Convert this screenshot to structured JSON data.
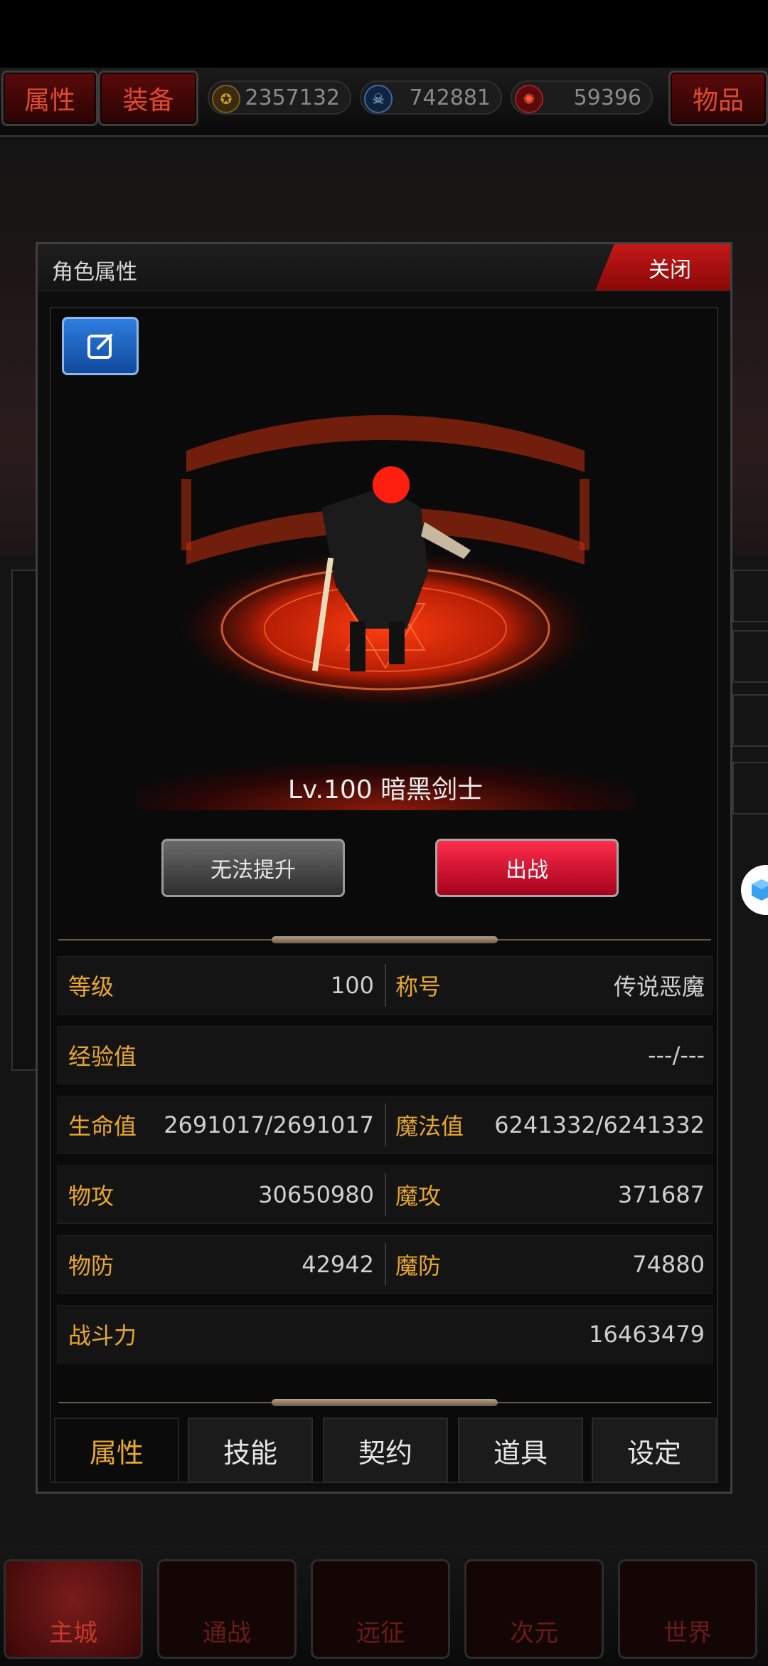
{
  "topbar": {
    "tab_attributes": "属性",
    "tab_equipment": "装备",
    "tab_items": "物品",
    "currencies": [
      {
        "icon": "gold-coin-icon",
        "value": "2357132"
      },
      {
        "icon": "blue-skull-icon",
        "value": "742881"
      },
      {
        "icon": "red-rune-icon",
        "value": "59396"
      }
    ]
  },
  "dialog": {
    "title": "角色属性",
    "close_label": "关闭",
    "character_name": "Lv.100 暗黑剑士",
    "btn_upgrade": "无法提升",
    "btn_deploy": "出战",
    "stats": {
      "level_label": "等级",
      "level_value": "100",
      "title_label": "称号",
      "title_value": "传说恶魔",
      "exp_label": "经验值",
      "exp_value": "---/---",
      "hp_label": "生命值",
      "hp_value": "2691017/2691017",
      "mp_label": "魔法值",
      "mp_value": "6241332/6241332",
      "patk_label": "物攻",
      "patk_value": "30650980",
      "matk_label": "魔攻",
      "matk_value": "371687",
      "pdef_label": "物防",
      "pdef_value": "42942",
      "mdef_label": "魔防",
      "mdef_value": "74880",
      "power_label": "战斗力",
      "power_value": "16463479"
    },
    "tabs": [
      "属性",
      "技能",
      "契约",
      "道具",
      "设定"
    ]
  },
  "bottom_nav": [
    "主城",
    "通战",
    "远征",
    "次元",
    "世界"
  ]
}
